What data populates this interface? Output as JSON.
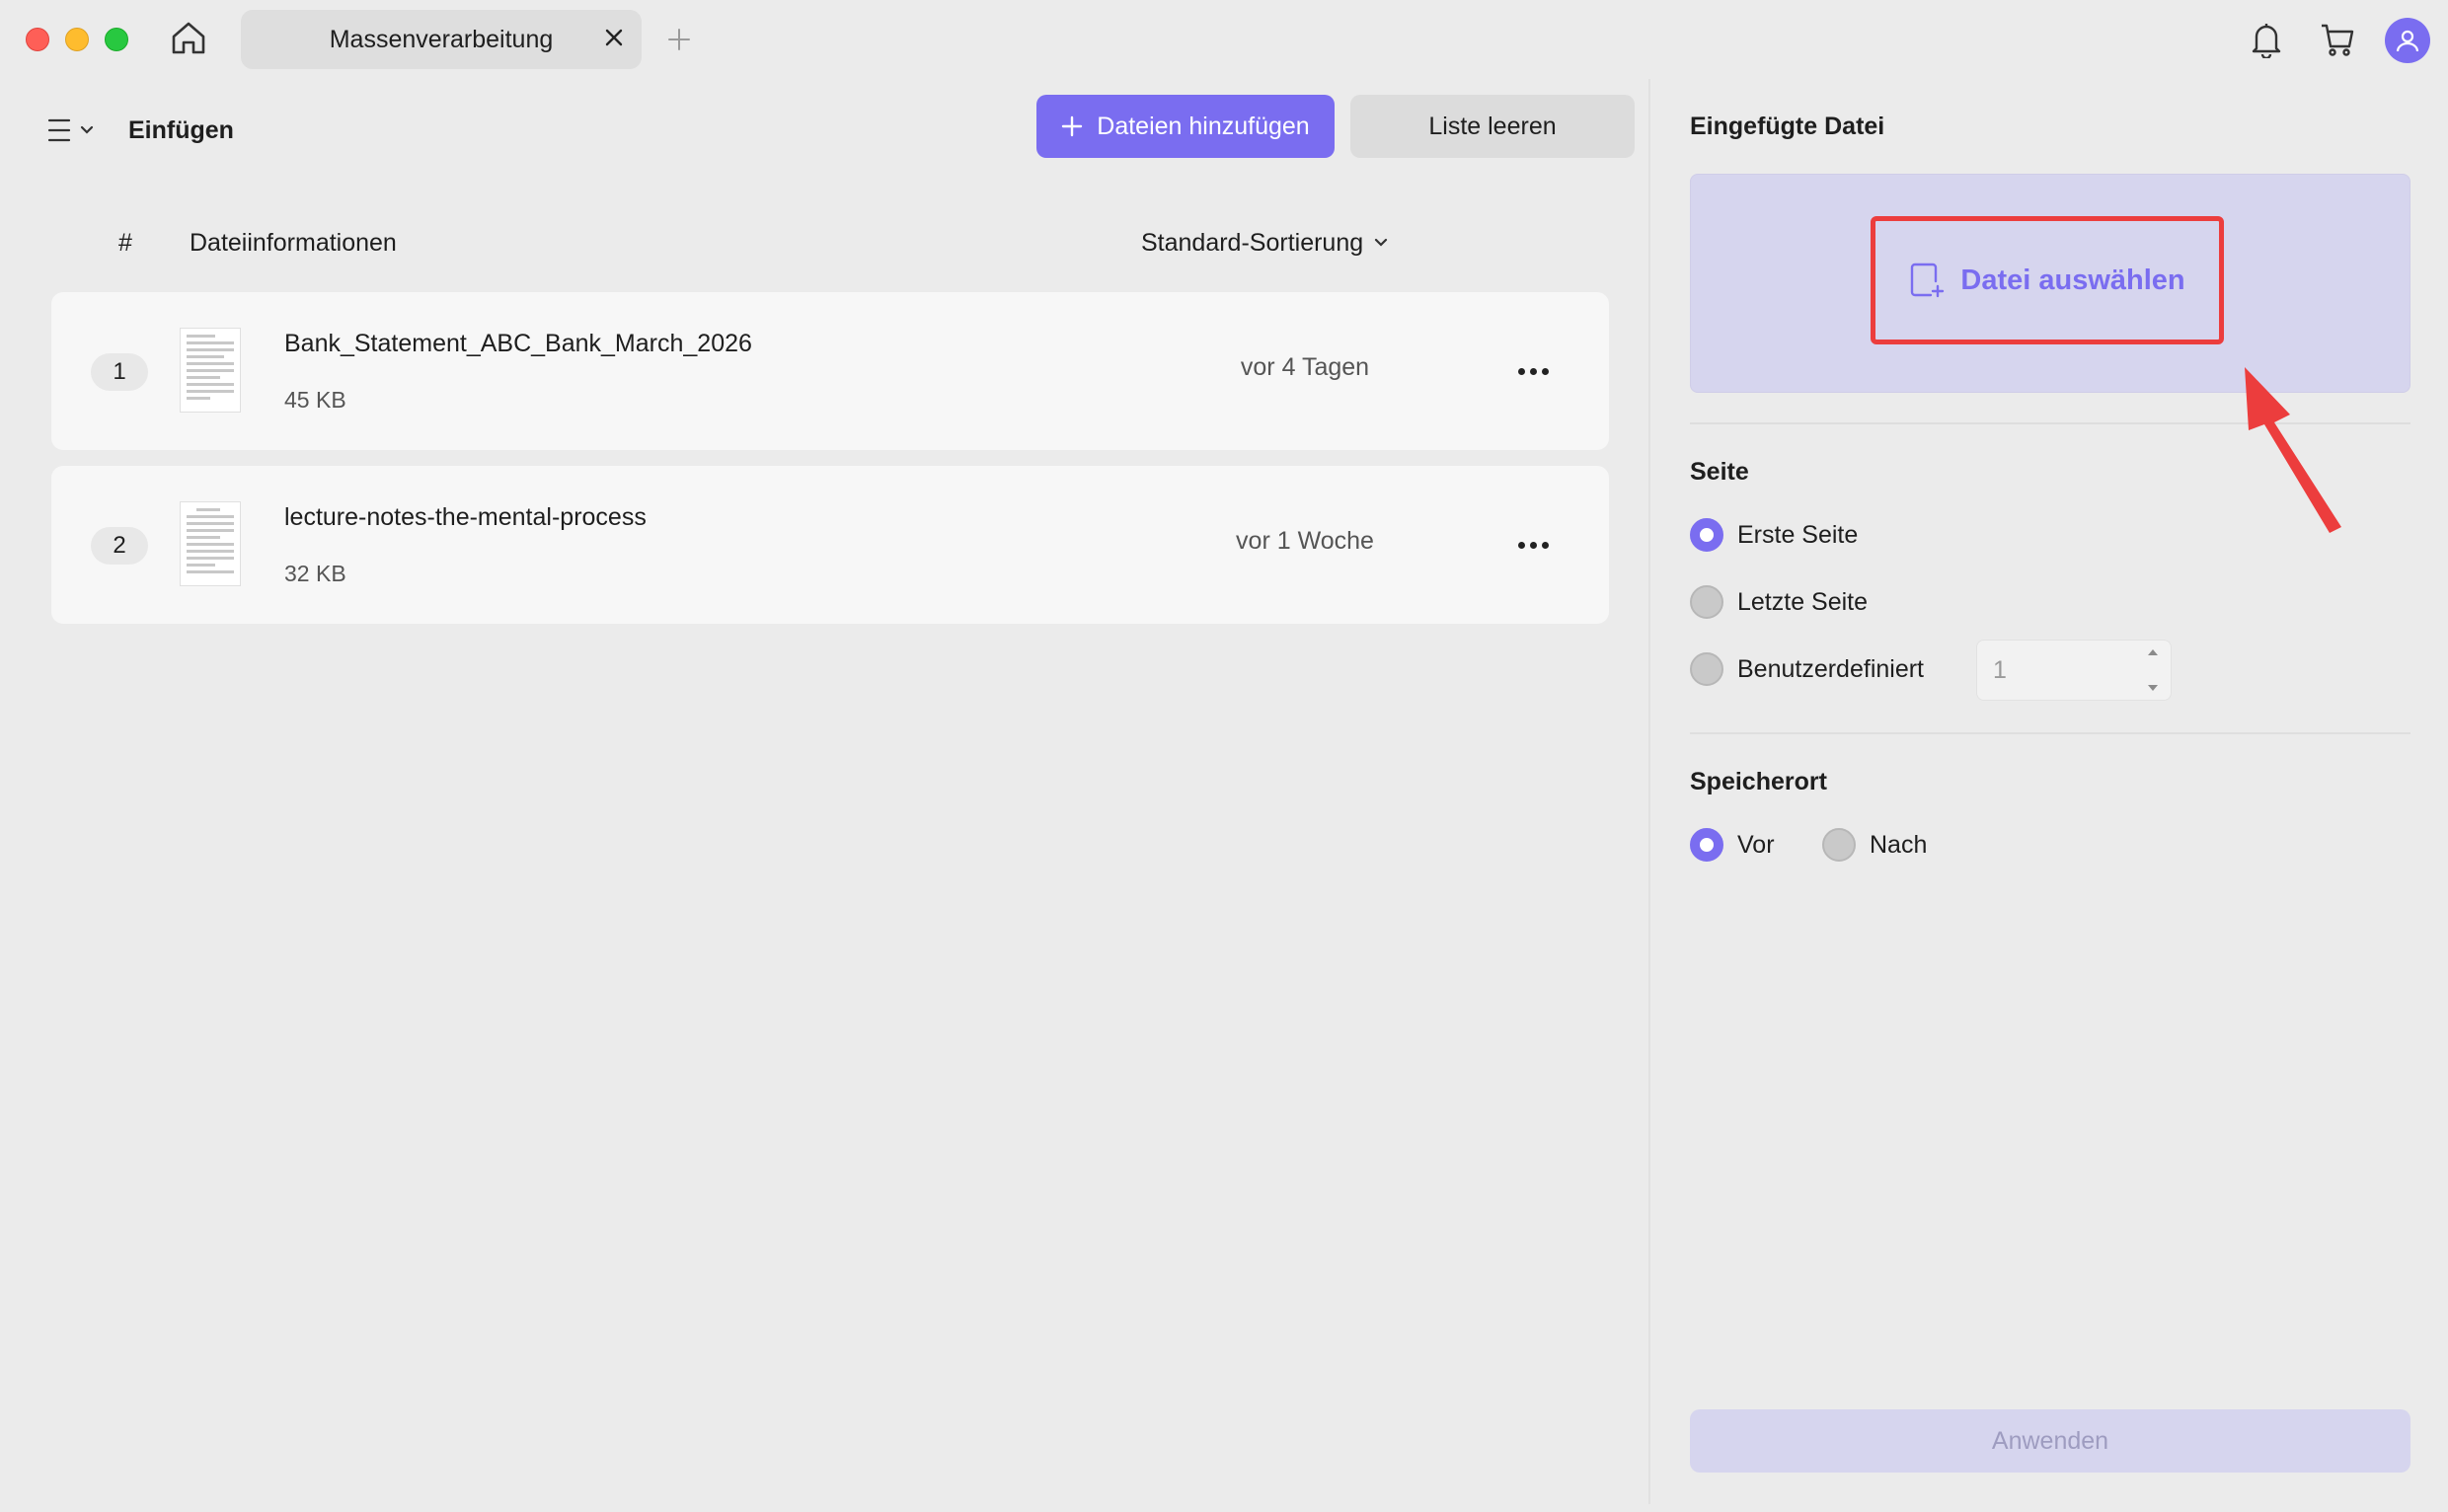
{
  "titlebar": {
    "tab_label": "Massenverarbeitung",
    "icons": [
      "home-icon",
      "close-icon",
      "plus-icon",
      "bell-icon",
      "cart-icon",
      "user-icon"
    ]
  },
  "toolbar": {
    "title": "Einfügen",
    "add_files_label": "Dateien hinzufügen",
    "clear_list_label": "Liste leeren"
  },
  "table": {
    "col_number": "#",
    "col_info": "Dateiinformationen",
    "sort_label": "Standard-Sortierung",
    "rows": [
      {
        "number": "1",
        "name": "Bank_Statement_ABC_Bank_March_2026",
        "size": "45 KB",
        "date": "vor 4 Tagen"
      },
      {
        "number": "2",
        "name": "lecture-notes-the-mental-process",
        "size": "32 KB",
        "date": "vor 1 Woche"
      }
    ]
  },
  "right_panel": {
    "inserted_file_title": "Eingefügte Datei",
    "select_file_label": "Datei auswählen",
    "page_section": {
      "title": "Seite",
      "options": [
        "Erste Seite",
        "Letzte Seite",
        "Benutzerdefiniert"
      ],
      "selected": "Erste Seite",
      "custom_value": "1"
    },
    "location_section": {
      "title": "Speicherort",
      "options": [
        "Vor",
        "Nach"
      ],
      "selected": "Vor"
    },
    "apply_label": "Anwenden"
  },
  "colors": {
    "accent": "#7a6df0",
    "highlight": "#ec3d3d",
    "drop_zone": "#d6d5ee"
  }
}
